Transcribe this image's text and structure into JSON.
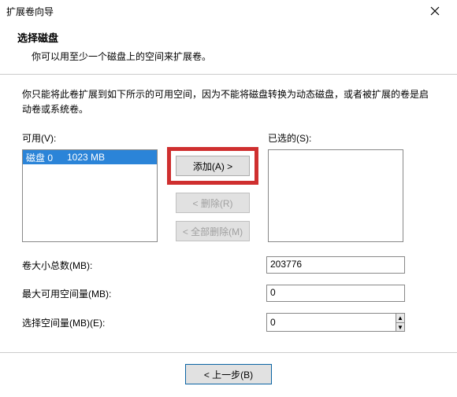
{
  "window": {
    "title": "扩展卷向导"
  },
  "header": {
    "title": "选择磁盘",
    "desc": "你可以用至少一个磁盘上的空间来扩展卷。"
  },
  "body": {
    "desc": "你只能将此卷扩展到如下所示的可用空间，因为不能将磁盘转换为动态磁盘，或者被扩展的卷是启动卷或系统卷。"
  },
  "lists": {
    "available_label": "可用(V):",
    "selected_label": "已选的(S):",
    "available_items": [
      {
        "disk": "磁盘 0",
        "size": "1023 MB",
        "selected": true
      }
    ],
    "selected_items": []
  },
  "buttons": {
    "add": "添加(A) >",
    "remove": "< 删除(R)",
    "remove_all": "< 全部删除(M)",
    "back": "< 上一步(B)"
  },
  "fields": {
    "total_label": "卷大小总数(MB):",
    "total_value": "203776",
    "max_label": "最大可用空间量(MB):",
    "max_value": "0",
    "select_label": "选择空间量(MB)(E):",
    "select_value": "0"
  }
}
